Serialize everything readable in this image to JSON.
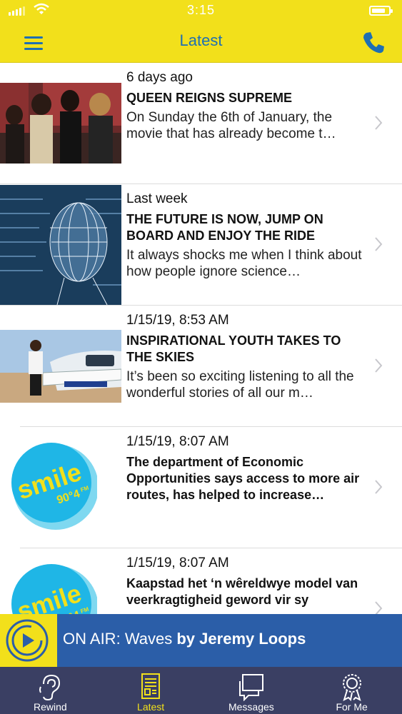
{
  "status_bar": {
    "time": "3:15"
  },
  "header": {
    "title": "Latest"
  },
  "colors": {
    "brand_yellow": "#f2e01b",
    "brand_blue": "#1e6fb3",
    "player_blue": "#2b5ea8",
    "tab_bg": "#3a3f63"
  },
  "items": [
    {
      "time": "6 days ago",
      "headline": "QUEEN REIGNS SUPREME",
      "summary": "On Sunday the 6th of January, the movie that has already become t…",
      "image": "band-photo"
    },
    {
      "time": "Last week",
      "headline": "THE FUTURE IS NOW, JUMP ON BOARD AND ENJOY THE RIDE",
      "summary": "It always shocks me when I think about how people ignore science…",
      "image": "wireframe-head"
    },
    {
      "time": "1/15/19, 8:53 AM",
      "headline": "INSPIRATIONAL YOUTH TAKES TO THE SKIES",
      "summary": "It’s been so exciting listening to all the wonderful stories of all our m…",
      "image": "pilot-aircraft"
    },
    {
      "time": "1/15/19, 8:07 AM",
      "headline": "The department of Economic Opportunities says access to more air routes, has helped to increase…",
      "summary": "",
      "image": "smile-logo"
    },
    {
      "time": "1/15/19, 8:07 AM",
      "headline": "Kaapstad het ‘n wêreldwye model van veerkragtigheid geword vir sy",
      "summary": "",
      "image": "smile-logo"
    }
  ],
  "logo": {
    "word": "smile",
    "freq": "90",
    "freq_dec": "4",
    "band": "FM"
  },
  "now_playing": {
    "prefix": "ON AIR:",
    "song": "Waves",
    "by": "by",
    "artist": "Jeremy Loops"
  },
  "tabs": [
    {
      "label": "Rewind",
      "icon": "ear-icon",
      "active": false
    },
    {
      "label": "Latest",
      "icon": "news-icon",
      "active": true
    },
    {
      "label": "Messages",
      "icon": "chat-icon",
      "active": false
    },
    {
      "label": "For Me",
      "icon": "badge-icon",
      "active": false
    }
  ]
}
